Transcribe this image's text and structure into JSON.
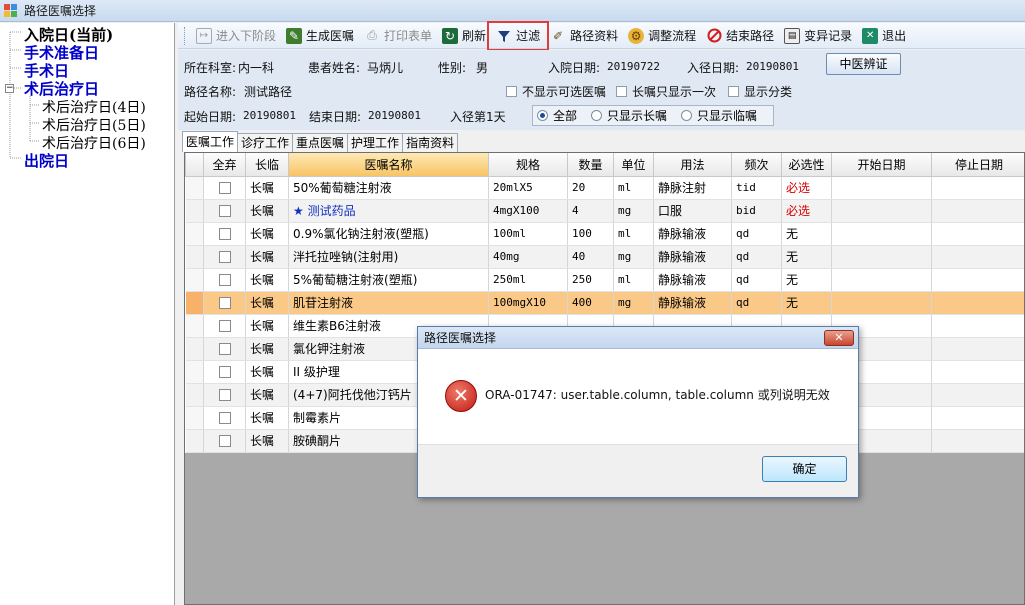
{
  "window": {
    "title": "路径医嘱选择"
  },
  "tree": {
    "nodes": [
      {
        "label": "入院日(当前)",
        "current": true
      },
      {
        "label": "手术准备日"
      },
      {
        "label": "手术日"
      },
      {
        "label": "术后治疗日",
        "expanded": true,
        "children": [
          "术后治疗日(4日)",
          "术后治疗日(5日)",
          "术后治疗日(6日)"
        ]
      },
      {
        "label": "出院日"
      }
    ]
  },
  "toolbar": {
    "buttons": [
      {
        "label": "进入下阶段",
        "icon": "next-stage-icon",
        "disabled": true
      },
      {
        "label": "生成医嘱",
        "icon": "generate-order-icon"
      },
      {
        "label": "打印表单",
        "icon": "print-icon",
        "disabled": true
      },
      {
        "label": "刷新",
        "icon": "refresh-icon"
      },
      {
        "label": "过滤",
        "icon": "filter-icon",
        "highlighted": true
      },
      {
        "label": "路径资料",
        "icon": "path-info-icon"
      },
      {
        "label": "调整流程",
        "icon": "adjust-flow-icon"
      },
      {
        "label": "结束路径",
        "icon": "end-path-icon"
      },
      {
        "label": "变异记录",
        "icon": "variation-record-icon"
      },
      {
        "label": "退出",
        "icon": "exit-icon"
      }
    ]
  },
  "info": {
    "dept_label": "所在科室:",
    "dept_value": "内一科",
    "patient_label": "患者姓名:",
    "patient_value": "马炳儿",
    "sex_label": "性别:",
    "sex_value": "男",
    "admit_label": "入院日期:",
    "admit_value": "20190722",
    "path_in_label": "入径日期:",
    "path_in_value": "20190801",
    "tcm_button": "中医辨证",
    "path_name_label": "路径名称:",
    "path_name_value": "测试路径",
    "chk_hide_optional": "不显示可选医嘱",
    "chk_long_once": "长嘱只显示一次",
    "chk_show_category": "显示分类",
    "start_label": "起始日期:",
    "start_value": "20190801",
    "end_label": "结束日期:",
    "end_value": "20190801",
    "day_label": "入径第1天",
    "radio_all": "全部",
    "radio_long": "只显示长嘱",
    "radio_temp": "只显示临嘱"
  },
  "tabs": [
    "医嘱工作",
    "诊疗工作",
    "重点医嘱",
    "护理工作",
    "指南资料"
  ],
  "grid": {
    "columns": [
      "全弃",
      "长临",
      "医嘱名称",
      "规格",
      "数量",
      "单位",
      "用法",
      "频次",
      "必选性",
      "开始日期",
      "停止日期"
    ],
    "rows": [
      {
        "type": "长嘱",
        "name": "50%葡萄糖注射液",
        "spec": "20mlX5",
        "qty": "20",
        "unit": "ml",
        "usage": "静脉注射",
        "freq": "tid",
        "req": "必选",
        "required": true
      },
      {
        "type": "长嘱",
        "name": "★ 测试药品",
        "spec": "4mgX100",
        "qty": "4",
        "unit": "mg",
        "usage": "口服",
        "freq": "bid",
        "req": "必选",
        "required": true,
        "starred": true
      },
      {
        "type": "长嘱",
        "name": "0.9%氯化钠注射液(塑瓶)",
        "spec": "100ml",
        "qty": "100",
        "unit": "ml",
        "usage": "静脉输液",
        "freq": "qd",
        "req": "无"
      },
      {
        "type": "长嘱",
        "name": "泮托拉唑钠(注射用)",
        "spec": "40mg",
        "qty": "40",
        "unit": "mg",
        "usage": "静脉输液",
        "freq": "qd",
        "req": "无"
      },
      {
        "type": "长嘱",
        "name": "5%葡萄糖注射液(塑瓶)",
        "spec": "250ml",
        "qty": "250",
        "unit": "ml",
        "usage": "静脉输液",
        "freq": "qd",
        "req": "无"
      },
      {
        "type": "长嘱",
        "name": "肌苷注射液",
        "spec": "100mgX10",
        "qty": "400",
        "unit": "mg",
        "usage": "静脉输液",
        "freq": "qd",
        "req": "无",
        "selected": true
      },
      {
        "type": "长嘱",
        "name": "维生素B6注射液",
        "spec": "",
        "qty": "",
        "unit": "",
        "usage": "",
        "freq": "",
        "req": ""
      },
      {
        "type": "长嘱",
        "name": "氯化钾注射液",
        "spec": "",
        "qty": "",
        "unit": "",
        "usage": "",
        "freq": "",
        "req": ""
      },
      {
        "type": "长嘱",
        "name": "II 级护理",
        "spec": "",
        "qty": "",
        "unit": "",
        "usage": "",
        "freq": "",
        "req": ""
      },
      {
        "type": "长嘱",
        "name": "(4+7)阿托伐他汀钙片",
        "spec": "",
        "qty": "",
        "unit": "",
        "usage": "",
        "freq": "",
        "req": ""
      },
      {
        "type": "长嘱",
        "name": "制霉素片",
        "spec": "",
        "qty": "",
        "unit": "",
        "usage": "",
        "freq": "",
        "req": ""
      },
      {
        "type": "长嘱",
        "name": "胺碘酮片",
        "spec": "",
        "qty": "",
        "unit": "",
        "usage": "",
        "freq": "",
        "req": ""
      }
    ]
  },
  "dialog": {
    "title": "路径医嘱选择",
    "close": "✕",
    "message": "ORA-01747: user.table.column, table.column 或列说明无效",
    "ok": "确定"
  }
}
